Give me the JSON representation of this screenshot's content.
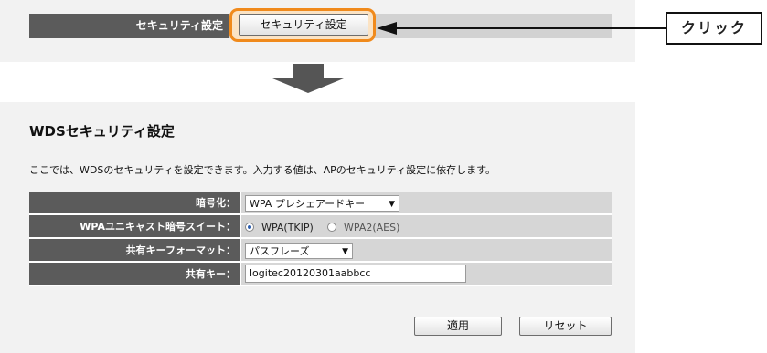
{
  "top": {
    "row_label": "セキュリティ設定",
    "button_label": "セキュリティ設定",
    "callout": "クリック"
  },
  "panel": {
    "title": "WDSセキュリティ設定",
    "description": "ここでは、WDSのセキュリティを設定できます。入力する値は、APのセキュリティ設定に依存します。",
    "rows": {
      "encryption": {
        "label": "暗号化：",
        "value": "WPA プレシェアードキー"
      },
      "cipher": {
        "label": "WPAユニキャスト暗号スイート：",
        "options": [
          "WPA(TKIP)",
          "WPA2(AES)"
        ],
        "selected": "WPA(TKIP)"
      },
      "key_format": {
        "label": "共有キーフォーマット：",
        "value": "パスフレーズ"
      },
      "shared_key": {
        "label": "共有キー：",
        "value": "logitec20120301aabbcc"
      }
    },
    "apply_label": "適用",
    "reset_label": "リセット"
  },
  "icons": {
    "dropdown": "chevron-down-icon",
    "left_arrow": "arrow-left-icon",
    "down_arrow": "arrow-down-icon"
  },
  "colors": {
    "highlight": "#f08a1c",
    "label_bg": "#5b5b5b",
    "panel_bg": "#f2f2f2"
  }
}
